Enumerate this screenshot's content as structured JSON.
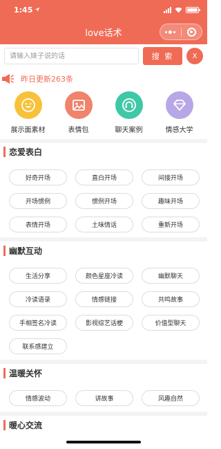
{
  "status": {
    "time": "1:45"
  },
  "nav": {
    "title": "love话术"
  },
  "search": {
    "placeholder": "请输入妹子说的话",
    "button_label": "搜 索",
    "clear_label": "X"
  },
  "update": {
    "text": "昨日更新263条"
  },
  "features": [
    {
      "label": "展示面素材",
      "icon": "smiley-icon",
      "color": "#F7C23A"
    },
    {
      "label": "表情包",
      "icon": "image-icon",
      "color": "#F0836C"
    },
    {
      "label": "聊天案例",
      "icon": "headphones-icon",
      "color": "#3FC8A6"
    },
    {
      "label": "情感大学",
      "icon": "diamond-icon",
      "color": "#B7A7E6"
    }
  ],
  "sections": [
    {
      "title": "恋爱表白",
      "tags": [
        "好奇开场",
        "直白开场",
        "间接开场",
        "开场惯例",
        "惯例开场",
        "趣味开场",
        "表情开场",
        "土味情话",
        "重新开场"
      ]
    },
    {
      "title": "幽默互动",
      "tags": [
        "生活分享",
        "颜色星座冷读",
        "幽默聊天",
        "冷读语录",
        "情感链接",
        "共鸣故事",
        "手相签名冷读",
        "影视综艺话梗",
        "价值型聊天",
        "联系感建立"
      ]
    },
    {
      "title": "温暖关怀",
      "tags": [
        "情感波动",
        "讲故事",
        "风趣自然"
      ]
    },
    {
      "title": "暖心交流",
      "tags": []
    }
  ]
}
